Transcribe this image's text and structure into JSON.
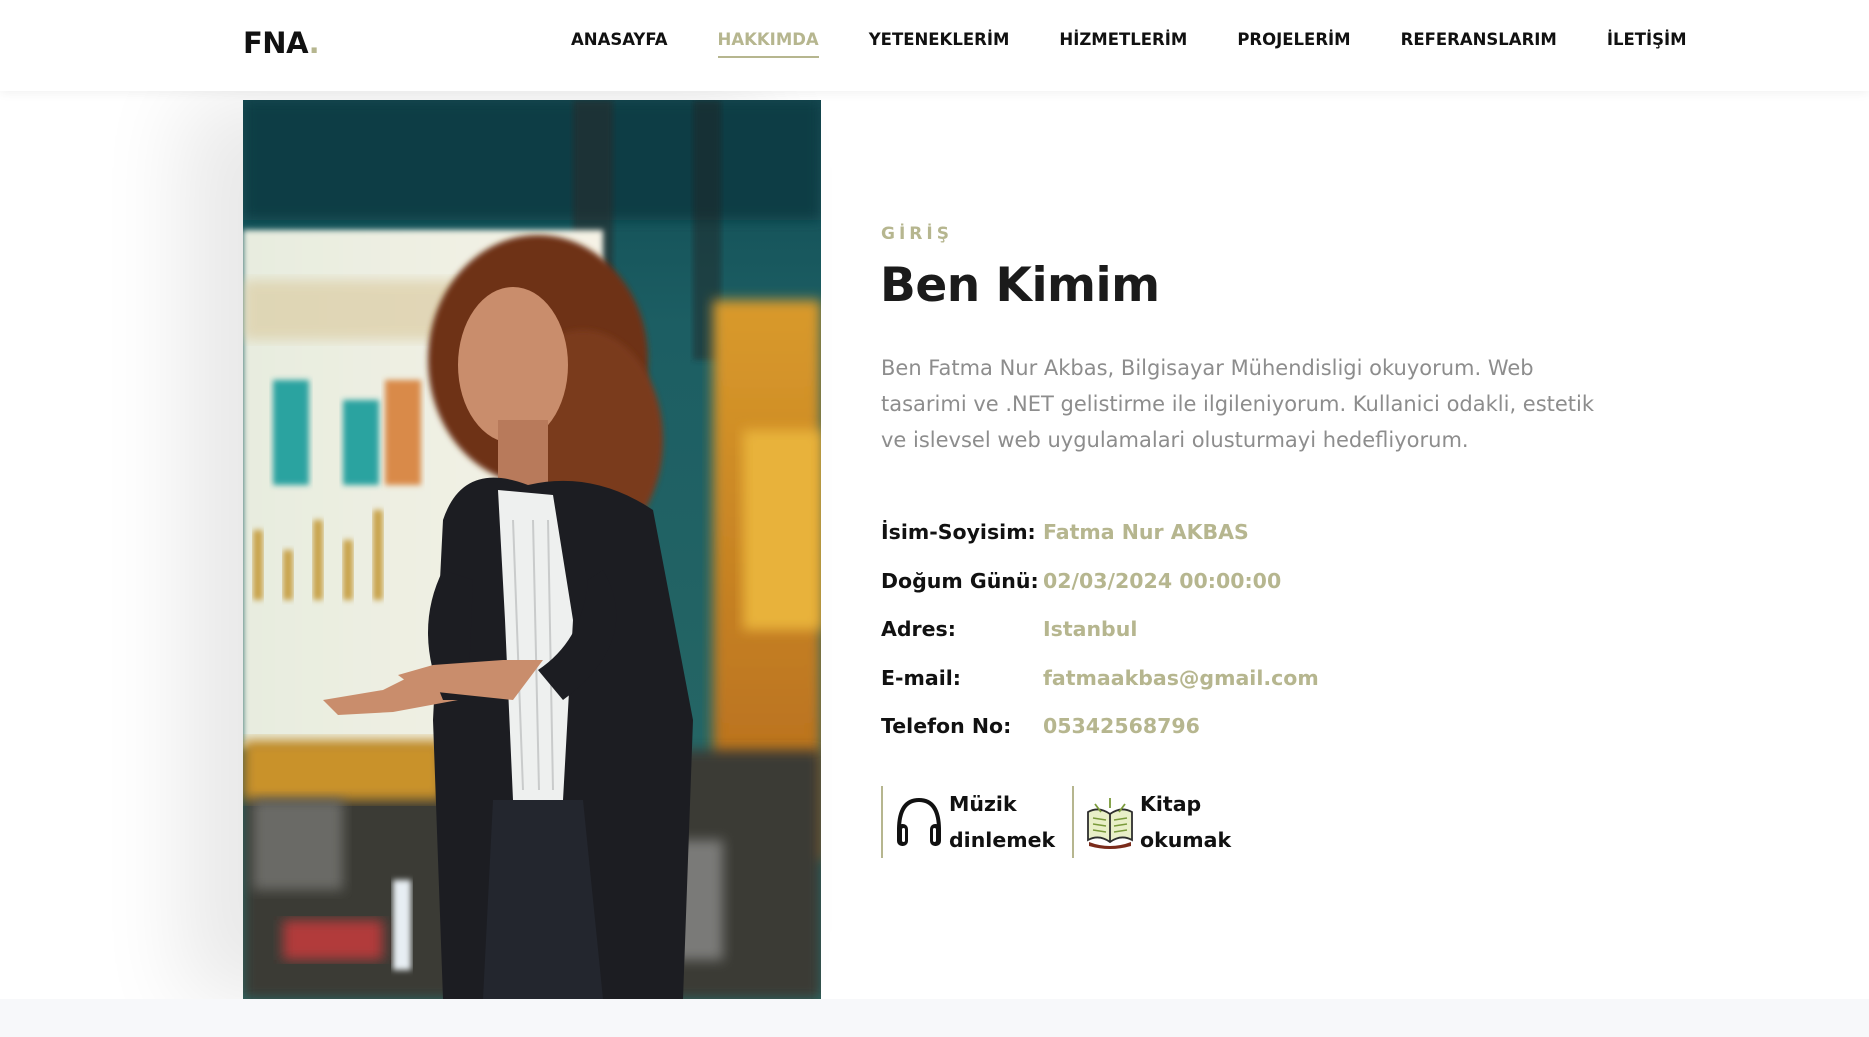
{
  "brand": {
    "name": "FNA",
    "dot": "."
  },
  "nav": [
    {
      "label": "ANASAYFA",
      "active": false
    },
    {
      "label": "HAKKIMDA",
      "active": true
    },
    {
      "label": "YETENEKLERİM",
      "active": false
    },
    {
      "label": "HİZMETLERİM",
      "active": false
    },
    {
      "label": "PROJELERİM",
      "active": false
    },
    {
      "label": "REFERANSLARIM",
      "active": false
    },
    {
      "label": "İLETİŞİM",
      "active": false
    }
  ],
  "about": {
    "section_label": "GİRİŞ",
    "title": "Ben Kimim",
    "bio": "Ben Fatma Nur Akbas, Bilgisayar Mühendisligi okuyorum. Web tasarimi ve .NET gelistirme ile ilgileniyorum. Kullanici odakli, estetik ve islevsel web uygulamalari olusturmayi hedefliyorum.",
    "info": [
      {
        "key": "İsim-Soyisim:",
        "value": "Fatma Nur AKBAS"
      },
      {
        "key": "Doğum Günü:",
        "value": "02/03/2024 00:00:00"
      },
      {
        "key": "Adres:",
        "value": "Istanbul"
      },
      {
        "key": "E-mail:",
        "value": "fatmaakbas@gmail.com"
      },
      {
        "key": "Telefon No:",
        "value": "05342568796"
      }
    ],
    "hobbies": [
      {
        "label_line1": "Müzik",
        "label_line2": "dinlemek",
        "icon": "headphones-icon"
      },
      {
        "label_line1": "Kitap",
        "label_line2": "okumak",
        "icon": "book-icon"
      }
    ]
  },
  "colors": {
    "accent": "#b6b68f",
    "text_dark": "#111111",
    "text_muted": "#8d8d8d",
    "footer_bg": "#f7f8fa"
  }
}
